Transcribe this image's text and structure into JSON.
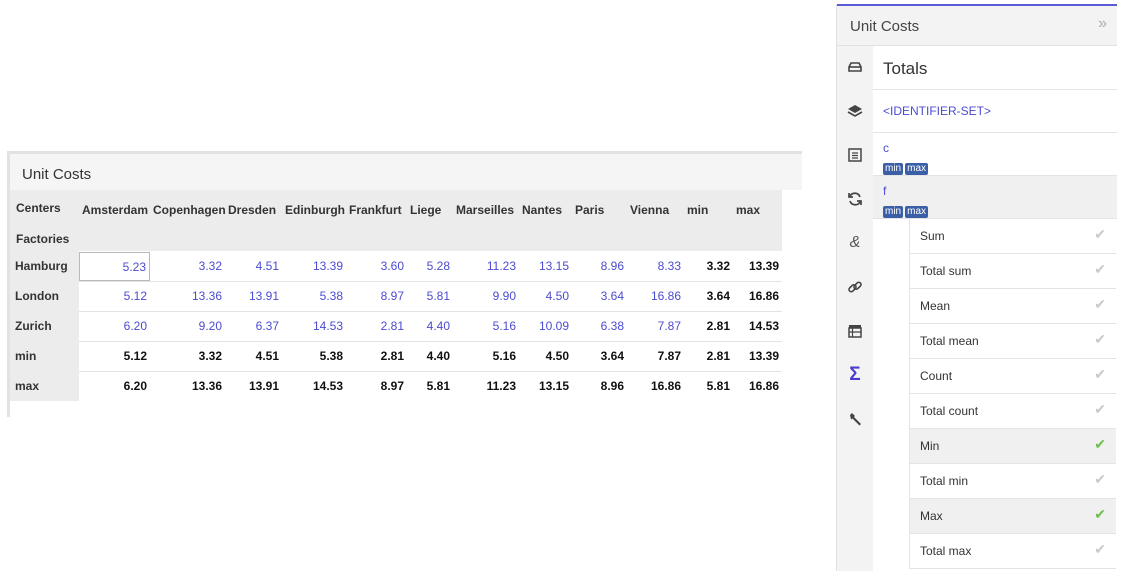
{
  "widget": {
    "title": "Unit Costs",
    "corner_top": "Centers",
    "corner_bottom": "Factories",
    "columns": [
      "Amsterdam",
      "Copenhagen",
      "Dresden",
      "Edinburgh",
      "Frankfurt",
      "Liege",
      "Marseilles",
      "Nantes",
      "Paris",
      "Vienna",
      "min",
      "max"
    ],
    "rows": [
      {
        "label": "Hamburg",
        "values": [
          "5.23",
          "3.32",
          "4.51",
          "13.39",
          "3.60",
          "5.28",
          "11.23",
          "13.15",
          "8.96",
          "8.33",
          "3.32",
          "13.39"
        ]
      },
      {
        "label": "London",
        "values": [
          "5.12",
          "13.36",
          "13.91",
          "5.38",
          "8.97",
          "5.81",
          "9.90",
          "4.50",
          "3.64",
          "16.86",
          "3.64",
          "16.86"
        ]
      },
      {
        "label": "Zurich",
        "values": [
          "6.20",
          "9.20",
          "6.37",
          "14.53",
          "2.81",
          "4.40",
          "5.16",
          "10.09",
          "6.38",
          "7.87",
          "2.81",
          "14.53"
        ]
      },
      {
        "label": "min",
        "values": [
          "5.12",
          "3.32",
          "4.51",
          "5.38",
          "2.81",
          "4.40",
          "5.16",
          "4.50",
          "3.64",
          "7.87",
          "2.81",
          "13.39"
        ]
      },
      {
        "label": "max",
        "values": [
          "6.20",
          "13.36",
          "13.91",
          "14.53",
          "8.97",
          "5.81",
          "11.23",
          "13.15",
          "8.96",
          "16.86",
          "5.81",
          "16.86"
        ]
      }
    ]
  },
  "panel": {
    "title": "Unit Costs",
    "collapse_icon": "double-chevron-right-icon",
    "icons": [
      "cube-icon",
      "layers-icon",
      "list-icon",
      "refresh-icon",
      "ampersand-icon",
      "link-icon",
      "table-icon",
      "sigma-icon",
      "wrench-icon"
    ],
    "section_title": "Totals",
    "identifier_set": "<IDENTIFIER-SET>",
    "identifiers": [
      {
        "name": "c",
        "badges": [
          "min",
          "max"
        ]
      },
      {
        "name": "f",
        "badges": [
          "min",
          "max"
        ]
      }
    ],
    "options": [
      {
        "label": "Sum",
        "checked": false
      },
      {
        "label": "Total sum",
        "checked": false
      },
      {
        "label": "Mean",
        "checked": false
      },
      {
        "label": "Total mean",
        "checked": false
      },
      {
        "label": "Count",
        "checked": false
      },
      {
        "label": "Total count",
        "checked": false
      },
      {
        "label": "Min",
        "checked": true
      },
      {
        "label": "Total min",
        "checked": false
      },
      {
        "label": "Max",
        "checked": true
      },
      {
        "label": "Total max",
        "checked": false
      }
    ],
    "check_glyph": "✔",
    "colors": {
      "accent": "#5b5bd6",
      "link": "#4b4bd0",
      "check_on": "#6cc04a",
      "badge": "#3b5fa6"
    }
  }
}
